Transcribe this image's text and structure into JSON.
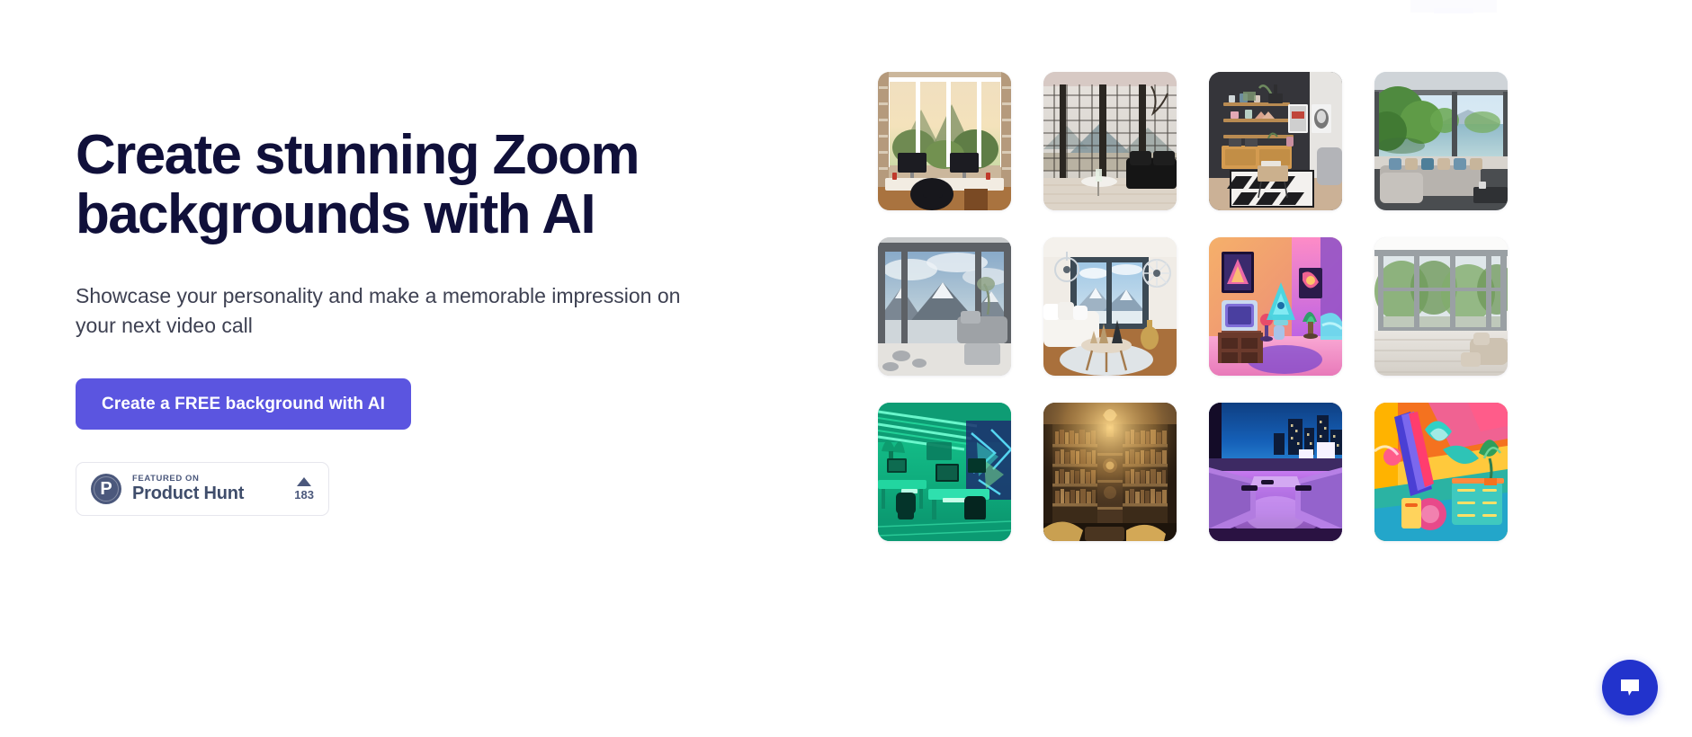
{
  "page": {
    "background_color": "#ffffff",
    "accent_color": "#5b55e0",
    "heading_color": "#10103a",
    "chat_color": "#2233cc"
  },
  "hero": {
    "title": "Create stunning Zoom backgrounds with AI",
    "subtitle": "Showcase your personality and make a memorable impression on your next video call",
    "cta_label": "Create a FREE background with AI"
  },
  "product_hunt": {
    "logo_letter": "P",
    "featured_label": "FEATURED ON",
    "name": "Product Hunt",
    "upvote_icon": "triangle-up-icon",
    "upvote_count": "183"
  },
  "gallery": {
    "columns": 4,
    "rows": 3,
    "items": [
      {
        "id": 1,
        "alt": "Sunset home office with large windows and forest view"
      },
      {
        "id": 2,
        "alt": "Loft room with tall grid windows and black leather sofa"
      },
      {
        "id": 3,
        "alt": "Modern dark-wall living room with shelves and geometric rug"
      },
      {
        "id": 4,
        "alt": "Lakeside living room with panoramic green nature view"
      },
      {
        "id": 5,
        "alt": "Snowy mountain view through floor-to-ceiling windows"
      },
      {
        "id": 6,
        "alt": "Cozy winter living room with white sofa and round table"
      },
      {
        "id": 7,
        "alt": "Neon synthwave room with retro TV and glowing lamp"
      },
      {
        "id": 8,
        "alt": "Bright white sunroom with glass walls and garden view"
      },
      {
        "id": 9,
        "alt": "Green neon gaming office with desks and monitors"
      },
      {
        "id": 10,
        "alt": "Warm vintage library with tall bookshelves and lantern"
      },
      {
        "id": 11,
        "alt": "Purple night-city lounge overlooking skyline"
      },
      {
        "id": 12,
        "alt": "Colorful abstract pop-art room with plants"
      }
    ]
  },
  "chat": {
    "icon": "chat-bubble-icon",
    "label": "Open chat"
  }
}
